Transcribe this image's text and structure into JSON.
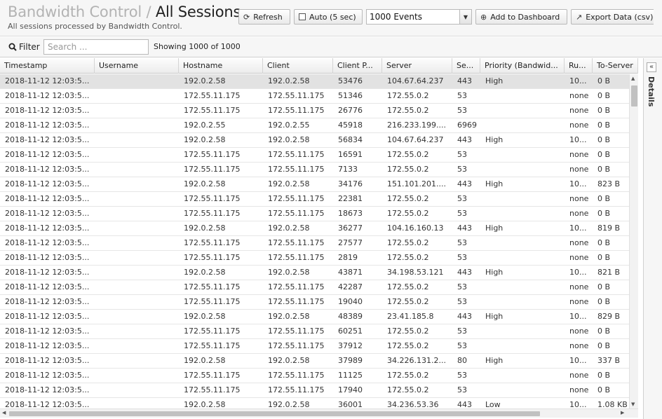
{
  "header": {
    "app_name": "Bandwidth Control",
    "separator": "/",
    "page_title": "All Sessions",
    "subtitle": "All sessions processed by Bandwidth Control.",
    "refresh_label": "Refresh",
    "auto_label": "Auto (5 sec)",
    "events_selected": "1000 Events",
    "add_dashboard_label": "Add to Dashboard",
    "export_label": "Export Data (csv)"
  },
  "filter": {
    "label": "Filter",
    "search_placeholder": "Search ...",
    "showing": "Showing 1000 of 1000"
  },
  "details": {
    "label": "Details",
    "collapse_glyph": "«"
  },
  "table": {
    "columns": [
      "Timestamp",
      "Username",
      "Hostname",
      "Client",
      "Client P...",
      "Server",
      "Se...",
      "Priority (Bandwid...",
      "Ru...",
      "To-Server"
    ],
    "rows": [
      [
        "2018-11-12 12:03:5...",
        "",
        "192.0.2.58",
        "192.0.2.58",
        "53476",
        "104.67.64.237",
        "443",
        "High",
        "10...",
        "0 B"
      ],
      [
        "2018-11-12 12:03:5...",
        "",
        "172.55.11.175",
        "172.55.11.175",
        "51346",
        "172.55.0.2",
        "53",
        "",
        "none",
        "0 B"
      ],
      [
        "2018-11-12 12:03:5...",
        "",
        "172.55.11.175",
        "172.55.11.175",
        "26776",
        "172.55.0.2",
        "53",
        "",
        "none",
        "0 B"
      ],
      [
        "2018-11-12 12:03:5...",
        "",
        "192.0.2.55",
        "192.0.2.55",
        "45918",
        "216.233.199....",
        "6969",
        "",
        "none",
        "0 B"
      ],
      [
        "2018-11-12 12:03:5...",
        "",
        "192.0.2.58",
        "192.0.2.58",
        "56834",
        "104.67.64.237",
        "443",
        "High",
        "10...",
        "0 B"
      ],
      [
        "2018-11-12 12:03:5...",
        "",
        "172.55.11.175",
        "172.55.11.175",
        "16591",
        "172.55.0.2",
        "53",
        "",
        "none",
        "0 B"
      ],
      [
        "2018-11-12 12:03:5...",
        "",
        "172.55.11.175",
        "172.55.11.175",
        "7133",
        "172.55.0.2",
        "53",
        "",
        "none",
        "0 B"
      ],
      [
        "2018-11-12 12:03:5...",
        "",
        "192.0.2.58",
        "192.0.2.58",
        "34176",
        "151.101.201....",
        "443",
        "High",
        "10...",
        "823 B"
      ],
      [
        "2018-11-12 12:03:5...",
        "",
        "172.55.11.175",
        "172.55.11.175",
        "22381",
        "172.55.0.2",
        "53",
        "",
        "none",
        "0 B"
      ],
      [
        "2018-11-12 12:03:5...",
        "",
        "172.55.11.175",
        "172.55.11.175",
        "18673",
        "172.55.0.2",
        "53",
        "",
        "none",
        "0 B"
      ],
      [
        "2018-11-12 12:03:5...",
        "",
        "192.0.2.58",
        "192.0.2.58",
        "36277",
        "104.16.160.13",
        "443",
        "High",
        "10...",
        "819 B"
      ],
      [
        "2018-11-12 12:03:5...",
        "",
        "172.55.11.175",
        "172.55.11.175",
        "27577",
        "172.55.0.2",
        "53",
        "",
        "none",
        "0 B"
      ],
      [
        "2018-11-12 12:03:5...",
        "",
        "172.55.11.175",
        "172.55.11.175",
        "2819",
        "172.55.0.2",
        "53",
        "",
        "none",
        "0 B"
      ],
      [
        "2018-11-12 12:03:5...",
        "",
        "192.0.2.58",
        "192.0.2.58",
        "43871",
        "34.198.53.121",
        "443",
        "High",
        "10...",
        "821 B"
      ],
      [
        "2018-11-12 12:03:5...",
        "",
        "172.55.11.175",
        "172.55.11.175",
        "42287",
        "172.55.0.2",
        "53",
        "",
        "none",
        "0 B"
      ],
      [
        "2018-11-12 12:03:5...",
        "",
        "172.55.11.175",
        "172.55.11.175",
        "19040",
        "172.55.0.2",
        "53",
        "",
        "none",
        "0 B"
      ],
      [
        "2018-11-12 12:03:5...",
        "",
        "192.0.2.58",
        "192.0.2.58",
        "48389",
        "23.41.185.8",
        "443",
        "High",
        "10...",
        "829 B"
      ],
      [
        "2018-11-12 12:03:5...",
        "",
        "172.55.11.175",
        "172.55.11.175",
        "60251",
        "172.55.0.2",
        "53",
        "",
        "none",
        "0 B"
      ],
      [
        "2018-11-12 12:03:5...",
        "",
        "172.55.11.175",
        "172.55.11.175",
        "37912",
        "172.55.0.2",
        "53",
        "",
        "none",
        "0 B"
      ],
      [
        "2018-11-12 12:03:5...",
        "",
        "192.0.2.58",
        "192.0.2.58",
        "37989",
        "34.226.131.2...",
        "80",
        "High",
        "10...",
        "337 B"
      ],
      [
        "2018-11-12 12:03:5...",
        "",
        "172.55.11.175",
        "172.55.11.175",
        "11125",
        "172.55.0.2",
        "53",
        "",
        "none",
        "0 B"
      ],
      [
        "2018-11-12 12:03:5...",
        "",
        "172.55.11.175",
        "172.55.11.175",
        "17940",
        "172.55.0.2",
        "53",
        "",
        "none",
        "0 B"
      ],
      [
        "2018-11-12 12:03:5...",
        "",
        "192.0.2.58",
        "192.0.2.58",
        "36001",
        "34.236.53.36",
        "443",
        "Low",
        "10...",
        "1.08 KB"
      ]
    ]
  }
}
